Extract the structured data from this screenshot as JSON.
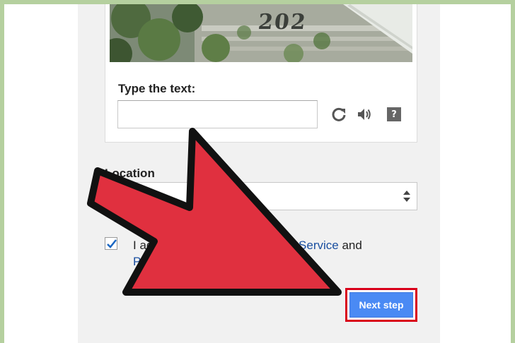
{
  "captcha": {
    "image_text": "202",
    "prompt_label": "Type the text:",
    "input_value": "",
    "refresh_icon": "refresh-icon",
    "audio_icon": "speaker-icon",
    "help_icon": "help-icon",
    "help_glyph": "?"
  },
  "location": {
    "label": "Location",
    "selected_value": ""
  },
  "terms": {
    "checked": true,
    "text_before": "I agree to the Google ",
    "terms_link": "Terms of Service",
    "text_middle": " and ",
    "privacy_link": "Privacy Policy"
  },
  "actions": {
    "next_label": "Next step"
  },
  "annotation": {
    "arrow_color": "#e0303f",
    "highlight_color": "#d9001a"
  },
  "colors": {
    "background": "#b5d09f",
    "panel": "#f1f1f1",
    "button": "#4a8af4",
    "link": "#1a4fa0"
  }
}
